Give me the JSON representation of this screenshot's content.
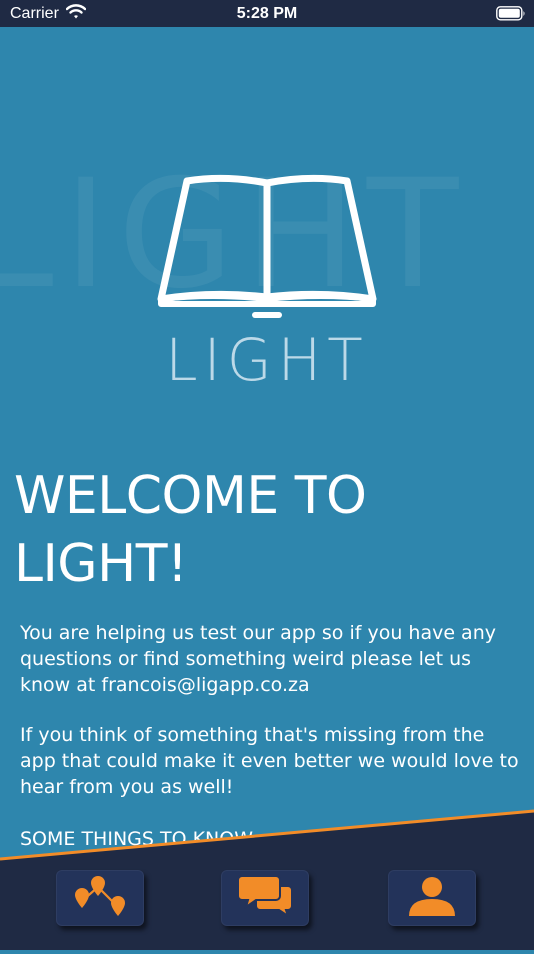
{
  "status_bar": {
    "carrier": "Carrier",
    "time": "5:28 PM",
    "wifi_icon": "wifi-icon",
    "battery_icon": "battery-icon"
  },
  "logo": {
    "icon": "open-book-icon",
    "word": "LIGHT",
    "background_word": "LIGHT"
  },
  "welcome": {
    "title": "WELCOME TO LIGHT!",
    "paragraph1": "You are helping us test our app so if you have any questions or find something weird please let us know at francois@ligapp.co.za",
    "paragraph2": "If you think of something that's missing from the app that could make it even better we would love to hear from you as well!",
    "paragraph3": "SOME THINGS TO KNOW..."
  },
  "tab_bar": {
    "tabs": [
      {
        "icon": "map-pins-icon"
      },
      {
        "icon": "chat-bubbles-icon"
      },
      {
        "icon": "user-profile-icon"
      }
    ]
  },
  "colors": {
    "background": "#2e86ad",
    "navy": "#1f2a44",
    "accent_orange": "#f28c28",
    "logo_text": "#bcd9e8"
  }
}
